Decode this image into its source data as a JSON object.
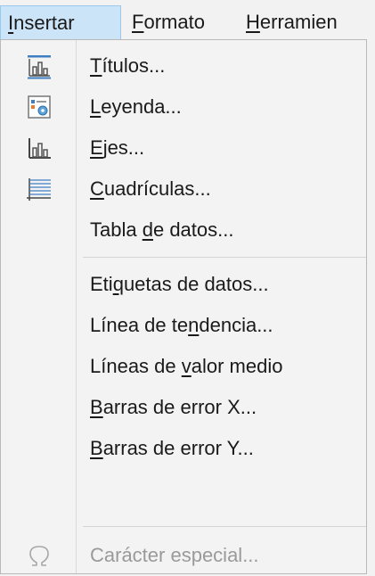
{
  "menubar": {
    "insertar": {
      "pre": "",
      "u": "I",
      "post": "nsertar"
    },
    "formato": {
      "pre": "",
      "u": "F",
      "post": "ormato"
    },
    "herramientas": {
      "pre": "",
      "u": "H",
      "post": "erramien"
    }
  },
  "menu": {
    "titulos": {
      "pre": "",
      "u": "T",
      "post": "ítulos...",
      "icon": "chart-titles-icon"
    },
    "leyenda": {
      "pre": "",
      "u": "L",
      "post": "eyenda...",
      "icon": "legend-icon"
    },
    "ejes": {
      "pre": "",
      "u": "E",
      "post": "jes...",
      "icon": "chart-axes-icon"
    },
    "cuadriculas": {
      "pre": "",
      "u": "C",
      "post": "uadrículas...",
      "icon": "grid-lines-icon"
    },
    "tabla": {
      "pre": "Tabla ",
      "u": "d",
      "post": "e datos..."
    },
    "etiquetas": {
      "pre": "Eti",
      "u": "q",
      "post": "uetas de datos..."
    },
    "tendencia": {
      "pre": "Línea de te",
      "u": "n",
      "post": "dencia..."
    },
    "valor_medio": {
      "pre": "Líneas de ",
      "u": "v",
      "post": "alor medio"
    },
    "error_x": {
      "pre": "",
      "u": "B",
      "post": "arras de error X..."
    },
    "error_y": {
      "pre": "",
      "u": "B",
      "post": "arras de error Y..."
    },
    "caracter": {
      "pre": "Carácter especial...",
      "u": "",
      "post": "",
      "icon": "omega-icon"
    }
  }
}
